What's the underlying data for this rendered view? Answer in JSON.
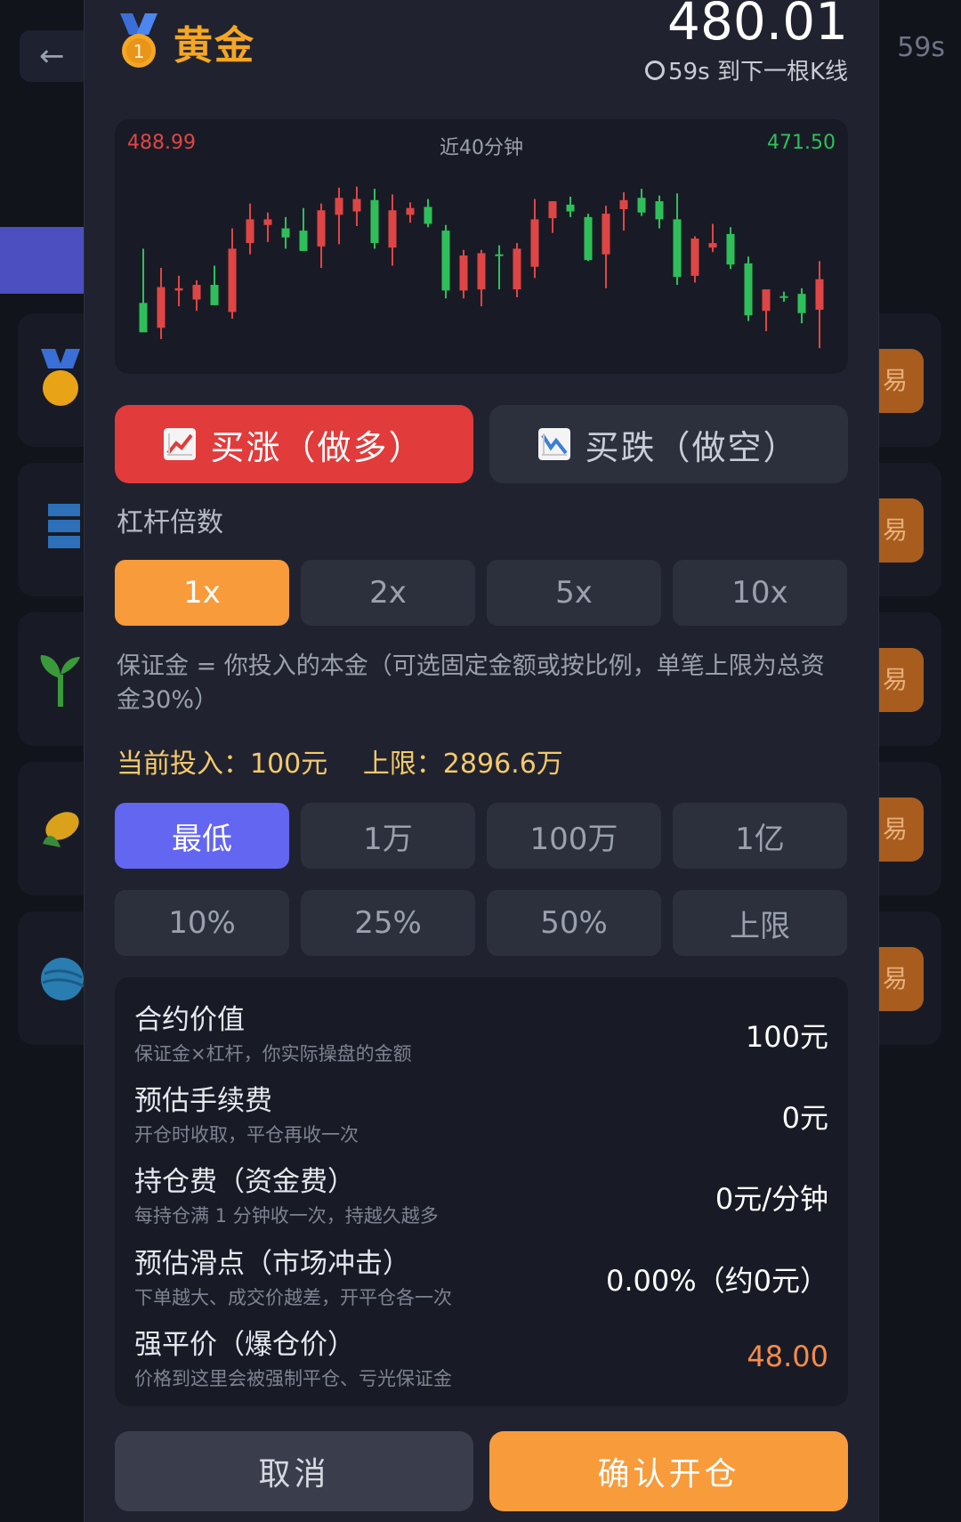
{
  "background": {
    "back_label": "←",
    "timer": "59s",
    "trade_label": "易"
  },
  "header": {
    "title": "黄金",
    "price": "480.01",
    "countdown": "59s 到下一根K线"
  },
  "chart": {
    "high_label": "488.99",
    "title": "近40分钟",
    "low_label": "471.50",
    "up_color": "#e04545",
    "down_color": "#2fbf5a"
  },
  "chart_data": {
    "type": "candlestick",
    "title": "近40分钟",
    "ylim": [
      471.5,
      488.99
    ],
    "candles": [
      {
        "o": 476.2,
        "h": 481.0,
        "l": 473.8,
        "c": 473.6
      },
      {
        "o": 474.0,
        "h": 479.3,
        "l": 473.0,
        "c": 477.6
      },
      {
        "o": 477.3,
        "h": 478.6,
        "l": 475.9,
        "c": 477.5
      },
      {
        "o": 476.5,
        "h": 478.2,
        "l": 475.5,
        "c": 477.8
      },
      {
        "o": 477.8,
        "h": 479.5,
        "l": 476.0,
        "c": 476.0
      },
      {
        "o": 475.4,
        "h": 482.8,
        "l": 474.8,
        "c": 481.0
      },
      {
        "o": 481.5,
        "h": 485.0,
        "l": 480.5,
        "c": 483.6
      },
      {
        "o": 483.1,
        "h": 484.2,
        "l": 481.6,
        "c": 483.6
      },
      {
        "o": 482.8,
        "h": 483.8,
        "l": 481.0,
        "c": 482.0
      },
      {
        "o": 482.6,
        "h": 484.6,
        "l": 480.8,
        "c": 480.8
      },
      {
        "o": 481.2,
        "h": 485.0,
        "l": 479.3,
        "c": 484.4
      },
      {
        "o": 484.0,
        "h": 486.4,
        "l": 481.4,
        "c": 485.5
      },
      {
        "o": 484.3,
        "h": 486.5,
        "l": 483.0,
        "c": 485.4
      },
      {
        "o": 485.3,
        "h": 486.3,
        "l": 481.0,
        "c": 481.5
      },
      {
        "o": 481.1,
        "h": 485.8,
        "l": 479.5,
        "c": 484.4
      },
      {
        "o": 484.0,
        "h": 485.1,
        "l": 483.3,
        "c": 484.6
      },
      {
        "o": 484.7,
        "h": 485.4,
        "l": 482.9,
        "c": 483.2
      },
      {
        "o": 482.6,
        "h": 483.1,
        "l": 476.6,
        "c": 477.3
      },
      {
        "o": 477.3,
        "h": 480.9,
        "l": 476.6,
        "c": 480.4
      },
      {
        "o": 477.4,
        "h": 480.9,
        "l": 475.9,
        "c": 480.6
      },
      {
        "o": 480.5,
        "h": 481.3,
        "l": 477.4,
        "c": 480.4
      },
      {
        "o": 477.4,
        "h": 481.5,
        "l": 476.7,
        "c": 481.0
      },
      {
        "o": 479.4,
        "h": 485.4,
        "l": 478.4,
        "c": 483.6
      },
      {
        "o": 483.7,
        "h": 485.2,
        "l": 482.4,
        "c": 485.2
      },
      {
        "o": 484.9,
        "h": 485.6,
        "l": 483.8,
        "c": 484.3
      },
      {
        "o": 483.8,
        "h": 484.1,
        "l": 479.9,
        "c": 480.0
      },
      {
        "o": 480.5,
        "h": 484.8,
        "l": 477.5,
        "c": 484.1
      },
      {
        "o": 484.5,
        "h": 486.0,
        "l": 482.6,
        "c": 485.3
      },
      {
        "o": 485.5,
        "h": 486.3,
        "l": 483.9,
        "c": 484.2
      },
      {
        "o": 485.2,
        "h": 485.7,
        "l": 482.8,
        "c": 483.6
      },
      {
        "o": 483.6,
        "h": 485.9,
        "l": 477.8,
        "c": 478.5
      },
      {
        "o": 478.6,
        "h": 482.1,
        "l": 478.0,
        "c": 481.9
      },
      {
        "o": 481.1,
        "h": 483.2,
        "l": 480.7,
        "c": 481.5
      },
      {
        "o": 482.3,
        "h": 482.9,
        "l": 479.2,
        "c": 479.6
      },
      {
        "o": 479.7,
        "h": 480.3,
        "l": 474.6,
        "c": 475.1
      },
      {
        "o": 475.5,
        "h": 476.9,
        "l": 473.7,
        "c": 477.4
      },
      {
        "o": 476.8,
        "h": 477.2,
        "l": 476.3,
        "c": 476.7
      },
      {
        "o": 477.0,
        "h": 477.5,
        "l": 474.4,
        "c": 475.3
      },
      {
        "o": 475.6,
        "h": 479.9,
        "l": 472.2,
        "c": 478.3
      }
    ]
  },
  "direction": {
    "long_label": "买涨（做多）",
    "short_label": "买跌（做空）"
  },
  "leverage": {
    "label": "杠杆倍数",
    "options": [
      "1x",
      "2x",
      "5x",
      "10x"
    ]
  },
  "margin_desc": "保证金 = 你投入的本金（可选固定金额或按比例，单笔上限为总资金30%）",
  "invest": {
    "current": "当前投入：100元",
    "limit": "上限：2896.6万"
  },
  "amounts": {
    "row1": [
      "最低",
      "1万",
      "100万",
      "1亿"
    ],
    "row2": [
      "10%",
      "25%",
      "50%",
      "上限"
    ]
  },
  "info": [
    {
      "label": "合约价值",
      "sub": "保证金×杠杆，你实际操盘的金额",
      "value": "100元"
    },
    {
      "label": "预估手续费",
      "sub": "开仓时收取，平仓再收一次",
      "value": "0元"
    },
    {
      "label": "持仓费（资金费）",
      "sub": "每持仓满 1 分钟收一次，持越久越多",
      "value": "0元/分钟"
    },
    {
      "label": "预估滑点（市场冲击）",
      "sub": "下单越大、成交价越差，开平仓各一次",
      "value": "0.00%（约0元）"
    },
    {
      "label": "强平价（爆仓价）",
      "sub": "价格到这里会被强制平仓、亏光保证金",
      "value": "48.00"
    }
  ],
  "footer": {
    "cancel": "取消",
    "confirm": "确认开仓"
  }
}
